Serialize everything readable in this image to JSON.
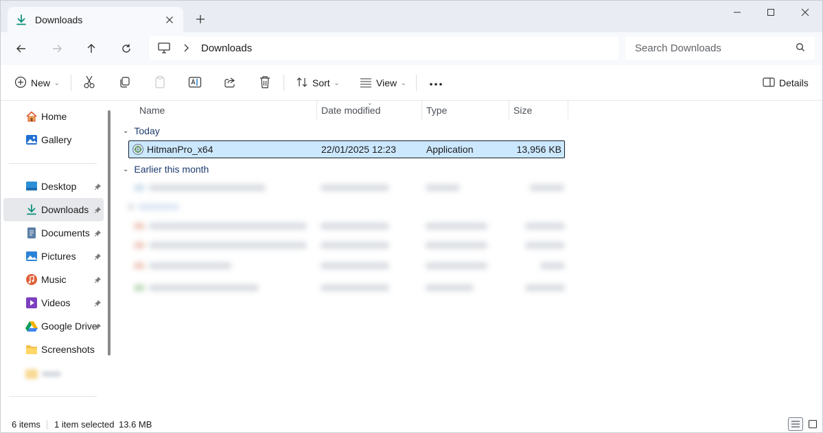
{
  "tab": {
    "title": "Downloads"
  },
  "address": {
    "crumb": "Downloads"
  },
  "search": {
    "placeholder": "Search Downloads"
  },
  "commands": {
    "new_label": "New",
    "sort_label": "Sort",
    "view_label": "View",
    "details_label": "Details"
  },
  "sidebar": {
    "home": "Home",
    "gallery": "Gallery",
    "desktop": "Desktop",
    "downloads": "Downloads",
    "documents": "Documents",
    "pictures": "Pictures",
    "music": "Music",
    "videos": "Videos",
    "google_drive": "Google Drive",
    "screenshots": "Screenshots"
  },
  "columns": {
    "name": "Name",
    "date": "Date modified",
    "type": "Type",
    "size": "Size"
  },
  "groups": {
    "today": "Today",
    "earlier": "Earlier this month"
  },
  "files": [
    {
      "name": "HitmanPro_x64",
      "date": "22/01/2025 12:23",
      "type": "Application",
      "size": "13,956 KB"
    }
  ],
  "status": {
    "items": "6 items",
    "selected": "1 item selected",
    "selected_size": "13.6 MB"
  },
  "colors": {
    "selection": "#cce8ff",
    "accent": "#0067c0",
    "group_text": "#1d3c6e"
  }
}
